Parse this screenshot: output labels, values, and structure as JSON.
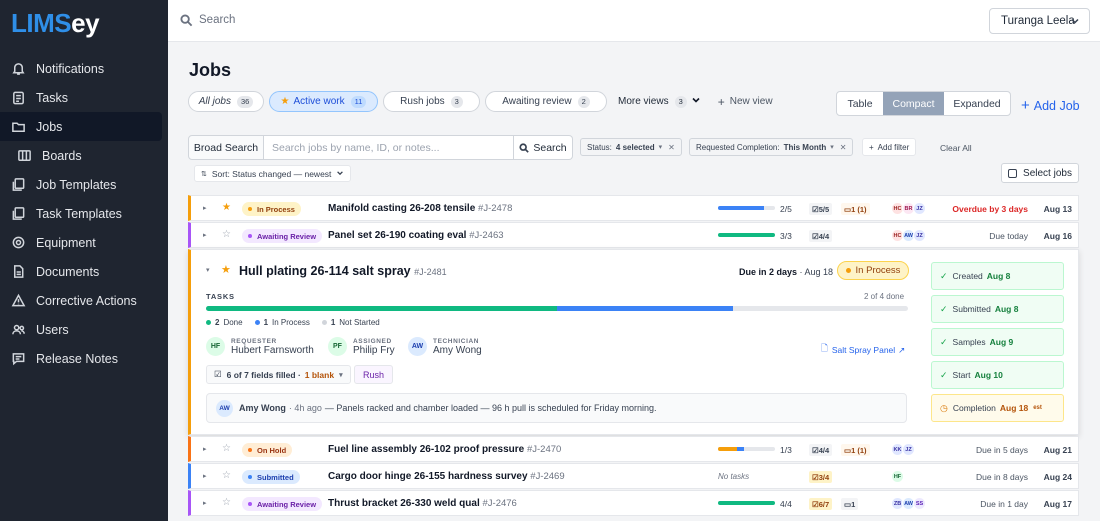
{
  "brand": {
    "logo_a": "LIMS",
    "logo_b": "ey"
  },
  "sidebar": {
    "items": [
      {
        "label": "Notifications",
        "icon": "bell-icon"
      },
      {
        "label": "Tasks",
        "icon": "clipboard-icon"
      },
      {
        "label": "Jobs",
        "icon": "folder-icon"
      },
      {
        "label": "Boards",
        "icon": "board-icon"
      },
      {
        "label": "Job Templates",
        "icon": "template-icon"
      },
      {
        "label": "Task Templates",
        "icon": "template-icon"
      },
      {
        "label": "Equipment",
        "icon": "gear-icon"
      },
      {
        "label": "Documents",
        "icon": "document-icon"
      },
      {
        "label": "Corrective Actions",
        "icon": "warning-icon"
      },
      {
        "label": "Users",
        "icon": "users-icon"
      },
      {
        "label": "Release Notes",
        "icon": "chat-icon"
      }
    ],
    "active": "Jobs"
  },
  "topbar": {
    "search_placeholder": "Search",
    "user": "Turanga Leela"
  },
  "page": {
    "title": "Jobs",
    "add_job": "Add Job"
  },
  "views": [
    {
      "label": "All jobs",
      "count": "36"
    },
    {
      "label": "Active work",
      "count": "11"
    },
    {
      "label": "Rush jobs",
      "count": "3"
    },
    {
      "label": "Awaiting review",
      "count": "2"
    }
  ],
  "more_views": {
    "label": "More views",
    "count": "3"
  },
  "new_view": "New view",
  "layout_modes": [
    "Table",
    "Compact",
    "Expanded"
  ],
  "filters": {
    "broad_search": "Broad Search",
    "search_placeholder": "Search jobs by name, ID, or notes...",
    "search_button": "Search",
    "status_label": "Status:",
    "status_value": "4 selected",
    "completion_label": "Requested Completion:",
    "completion_value": "This Month",
    "add_filter": "Add filter",
    "clear_all": "Clear All",
    "sort": "Sort: Status changed — newest",
    "select_jobs": "Select jobs"
  },
  "rows": [
    {
      "status": "In Process",
      "name": "Manifold casting 26-208 tensile",
      "id": "#J-2478",
      "progress": "2/5",
      "tasks": "5/5",
      "comments": "1 (1)",
      "avatars": [
        "HC",
        "BR",
        "JZ"
      ],
      "due": "Overdue by 3 days",
      "date": "Aug 13",
      "starred": true
    },
    {
      "status": "Awaiting Review",
      "name": "Panel set 26-190 coating eval",
      "id": "#J-2463",
      "progress": "3/3",
      "tasks": "4/4",
      "comments": "",
      "avatars": [
        "HC",
        "AW",
        "JZ"
      ],
      "due": "Due today",
      "date": "Aug 16",
      "starred": false
    },
    {
      "status": "On Hold",
      "name": "Fuel line assembly 26-102 proof pressure",
      "id": "#J-2470",
      "progress": "1/3",
      "tasks": "4/4",
      "comments": "1 (1)",
      "avatars": [
        "KK",
        "JZ"
      ],
      "due": "Due in 5 days",
      "date": "Aug 21",
      "starred": false
    },
    {
      "status": "Submitted",
      "name": "Cargo door hinge 26-155 hardness survey",
      "id": "#J-2469",
      "progress": "No tasks",
      "tasks": "3/4",
      "comments": "",
      "avatars": [
        "HF"
      ],
      "due": "Due in 8 days",
      "date": "Aug 24",
      "starred": false
    },
    {
      "status": "Awaiting Review",
      "name": "Thrust bracket 26-330 weld qual",
      "id": "#J-2476",
      "progress": "4/4",
      "tasks": "6/7",
      "comments": "1",
      "avatars": [
        "ZB",
        "AW",
        "SS"
      ],
      "due": "Due in 1 day",
      "date": "Aug 17",
      "starred": false
    }
  ],
  "expanded": {
    "name": "Hull plating 26-114 salt spray",
    "id": "#J-2481",
    "due_prefix": "Due in 2 days",
    "due_date": " · Aug 18",
    "status": "In Process",
    "tasks_label": "TASKS",
    "tasks_count": "2 of 4 done",
    "done": {
      "n": "2",
      "label": "Done"
    },
    "in_process": {
      "n": "1",
      "label": "In Process"
    },
    "not_started": {
      "n": "1",
      "label": "Not Started"
    },
    "requester": {
      "role": "REQUESTER",
      "name": "Hubert Farnsworth",
      "initials": "HF"
    },
    "assigned": {
      "role": "ASSIGNED",
      "name": "Philip Fry",
      "initials": "PF"
    },
    "technician": {
      "role": "TECHNICIAN",
      "name": "Amy Wong",
      "initials": "AW"
    },
    "panel_link": "Salt Spray Panel",
    "fields": "6 of 7 fields filled ·",
    "blank": "1 blank",
    "rush": "Rush",
    "comment": {
      "initials": "AW",
      "author": "Amy Wong",
      "ago": "· 4h ago",
      "text": "— Panels racked and chamber loaded — 96 h pull is scheduled for Friday morning."
    },
    "timeline": [
      {
        "label": "Created",
        "date": "Aug 8"
      },
      {
        "label": "Submitted",
        "date": "Aug 8"
      },
      {
        "label": "Samples",
        "date": "Aug 9"
      },
      {
        "label": "Start",
        "date": "Aug 10"
      },
      {
        "label": "Completion",
        "date": "Aug 18",
        "tag": "est"
      }
    ]
  }
}
